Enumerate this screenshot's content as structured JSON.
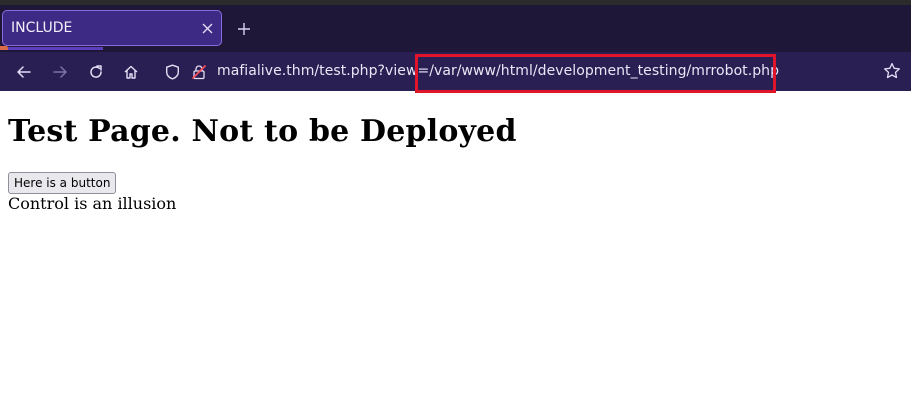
{
  "browser": {
    "tab": {
      "title": "INCLUDE"
    },
    "url": "mafialive.thm/test.php?view=/var/www/html/development_testing/mrrobot.php",
    "icons": {
      "tab_close": "close-icon",
      "new_tab": "plus-icon",
      "back": "arrow-left-icon",
      "forward": "arrow-right-icon",
      "reload": "reload-icon",
      "home": "home-icon",
      "shield": "shield-icon",
      "lock": "lock-icon",
      "bookmark": "star-icon"
    },
    "colors": {
      "tabstrip": "#1f1738",
      "toolbar": "#2a1f52",
      "active_tab": "#3d2a85",
      "highlight": "#e0142a"
    }
  },
  "page": {
    "heading": "Test Page. Not to be Deployed",
    "button_label": "Here is a button",
    "text": "Control is an illusion"
  }
}
